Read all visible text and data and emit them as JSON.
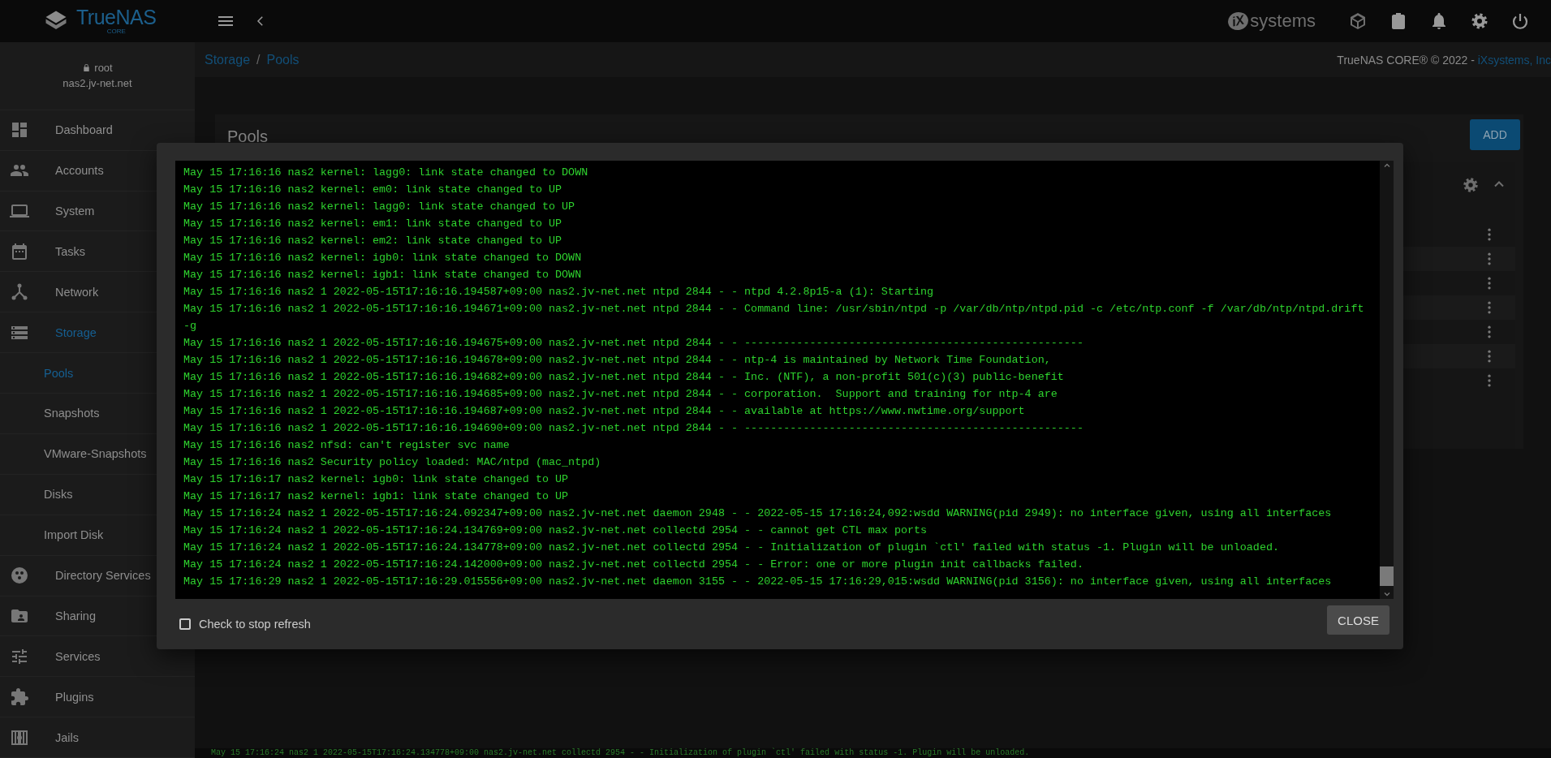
{
  "header": {
    "logo": {
      "name": "TrueNAS",
      "edition": "CORE"
    },
    "vendor": {
      "mark": "iX",
      "name": "systems"
    }
  },
  "user": {
    "name": "root",
    "host": "nas2.jv-net.net"
  },
  "sidebar": {
    "items": [
      {
        "label": "Dashboard",
        "selected": false
      },
      {
        "label": "Accounts",
        "selected": false
      },
      {
        "label": "System",
        "selected": false
      },
      {
        "label": "Tasks",
        "selected": false
      },
      {
        "label": "Network",
        "selected": false
      },
      {
        "label": "Storage",
        "selected": true,
        "children": [
          {
            "label": "Pools",
            "selected": true
          },
          {
            "label": "Snapshots",
            "selected": false
          },
          {
            "label": "VMware-Snapshots",
            "selected": false
          },
          {
            "label": "Disks",
            "selected": false
          },
          {
            "label": "Import Disk",
            "selected": false
          }
        ]
      },
      {
        "label": "Directory Services",
        "selected": false
      },
      {
        "label": "Sharing",
        "selected": false
      },
      {
        "label": "Services",
        "selected": false
      },
      {
        "label": "Plugins",
        "selected": false
      },
      {
        "label": "Jails",
        "selected": false
      }
    ]
  },
  "breadcrumb": {
    "links": [
      "Storage",
      "Pools"
    ],
    "separator": "/"
  },
  "copyright": {
    "text": "TrueNAS CORE® © 2022 -",
    "link": "iXsystems, Inc"
  },
  "pools": {
    "title": "Pools",
    "add_button": "ADD"
  },
  "dialog": {
    "lines": [
      "May 15 17:16:16 nas2 kernel: lagg0: link state changed to DOWN",
      "May 15 17:16:16 nas2 kernel: em0: link state changed to UP",
      "May 15 17:16:16 nas2 kernel: lagg0: link state changed to UP",
      "May 15 17:16:16 nas2 kernel: em1: link state changed to UP",
      "May 15 17:16:16 nas2 kernel: em2: link state changed to UP",
      "May 15 17:16:16 nas2 kernel: igb0: link state changed to DOWN",
      "May 15 17:16:16 nas2 kernel: igb1: link state changed to DOWN",
      "May 15 17:16:16 nas2 1 2022-05-15T17:16:16.194587+09:00 nas2.jv-net.net ntpd 2844 - - ntpd 4.2.8p15-a (1): Starting",
      "May 15 17:16:16 nas2 1 2022-05-15T17:16:16.194671+09:00 nas2.jv-net.net ntpd 2844 - - Command line: /usr/sbin/ntpd -p /var/db/ntp/ntpd.pid -c /etc/ntp.conf -f /var/db/ntp/ntpd.drift",
      "-g",
      "May 15 17:16:16 nas2 1 2022-05-15T17:16:16.194675+09:00 nas2.jv-net.net ntpd 2844 - - ----------------------------------------------------",
      "May 15 17:16:16 nas2 1 2022-05-15T17:16:16.194678+09:00 nas2.jv-net.net ntpd 2844 - - ntp-4 is maintained by Network Time Foundation,",
      "May 15 17:16:16 nas2 1 2022-05-15T17:16:16.194682+09:00 nas2.jv-net.net ntpd 2844 - - Inc. (NTF), a non-profit 501(c)(3) public-benefit",
      "May 15 17:16:16 nas2 1 2022-05-15T17:16:16.194685+09:00 nas2.jv-net.net ntpd 2844 - - corporation.  Support and training for ntp-4 are",
      "May 15 17:16:16 nas2 1 2022-05-15T17:16:16.194687+09:00 nas2.jv-net.net ntpd 2844 - - available at https://www.nwtime.org/support",
      "May 15 17:16:16 nas2 1 2022-05-15T17:16:16.194690+09:00 nas2.jv-net.net ntpd 2844 - - ----------------------------------------------------",
      "May 15 17:16:16 nas2 nfsd: can't register svc name",
      "May 15 17:16:16 nas2 Security policy loaded: MAC/ntpd (mac_ntpd)",
      "May 15 17:16:17 nas2 kernel: igb0: link state changed to UP",
      "May 15 17:16:17 nas2 kernel: igb1: link state changed to UP",
      "May 15 17:16:24 nas2 1 2022-05-15T17:16:24.092347+09:00 nas2.jv-net.net daemon 2948 - - 2022-05-15 17:16:24,092:wsdd WARNING(pid 2949): no interface given, using all interfaces",
      "May 15 17:16:24 nas2 1 2022-05-15T17:16:24.134769+09:00 nas2.jv-net.net collectd 2954 - - cannot get CTL max ports",
      "May 15 17:16:24 nas2 1 2022-05-15T17:16:24.134778+09:00 nas2.jv-net.net collectd 2954 - - Initialization of plugin `ctl' failed with status -1. Plugin will be unloaded.",
      "May 15 17:16:24 nas2 1 2022-05-15T17:16:24.142000+09:00 nas2.jv-net.net collectd 2954 - - Error: one or more plugin init callbacks failed.",
      "May 15 17:16:29 nas2 1 2022-05-15T17:16:29.015556+09:00 nas2.jv-net.net daemon 3155 - - 2022-05-15 17:16:29,015:wsdd WARNING(pid 3156): no interface given, using all interfaces"
    ],
    "stop_refresh": {
      "label": "Check to stop refresh",
      "checked": false
    },
    "close_button": "CLOSE"
  },
  "ticker": "May 15 17:16:24 nas2 1 2022-05-15T17:16:24.134778+09:00 nas2.jv-net.net collectd 2954 - - Initialization of plugin `ctl' failed with status -1. Plugin will be unloaded."
}
